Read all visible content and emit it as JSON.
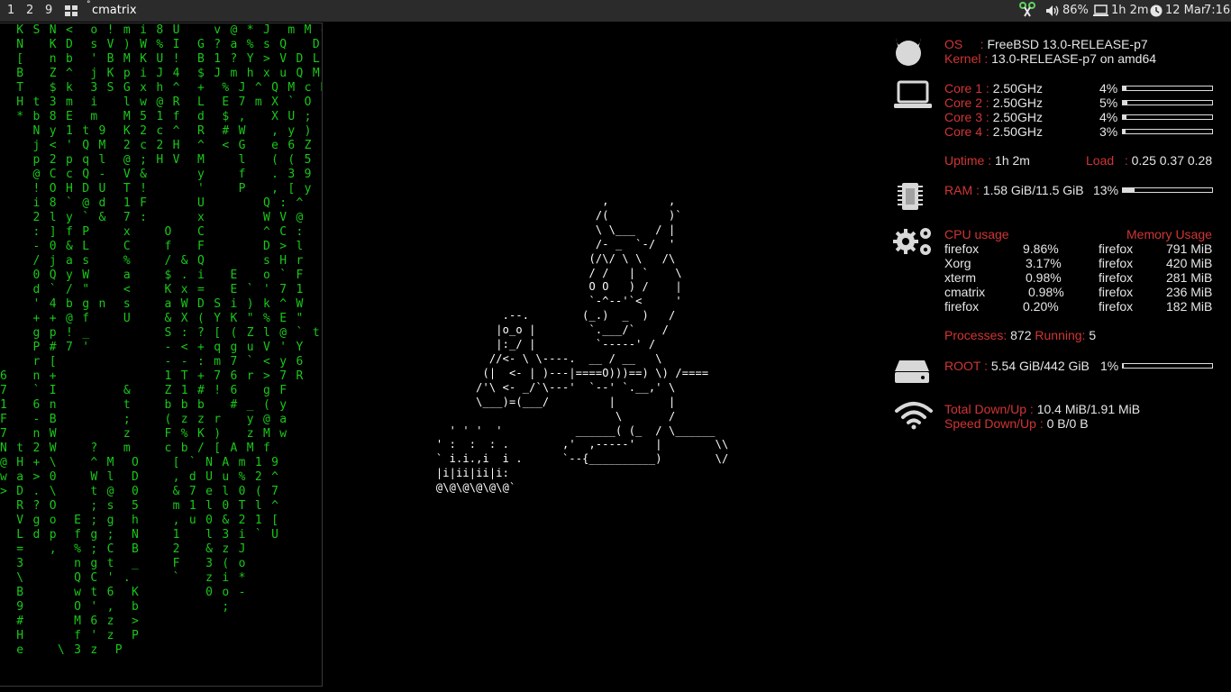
{
  "panel": {
    "workspaces": [
      "1",
      "2",
      "9"
    ],
    "window_title": "cmatrix",
    "volume": "86%",
    "uptime": "1h 2m",
    "date": "12 Mar",
    "time": "7:16",
    "colors": {
      "bg": "#2b2b2b",
      "fg": "#e6e6e6"
    }
  },
  "terminal": {
    "matrix": "  K S N <  o ! m i 8 U    v @ * J  m M d\n  N   K D  s V ) W % I  G ? a % s Q   D\n  [   n b  ' B M K U !  B 1 ? Y > V D L\n  B   Z ^  j K p i J 4  $ J m h x u Q M\n  T   $ k  3 S G x h ^  +  % J ^ Q M c M\n  H t 3 m  i   l w @ R  L  E 7 m X ` O\n  * b 8 E  m   M 5 1 f  d  $ ,   X U ;\n    N y 1 t 9  K 2 c ^  R  # W   , y )\n    j < ' Q M  2 c 2 H  ^  < G   e 6 Z\n    p 2 p q l  @ ; H V  M    l   ( ( 5\n    @ C c Q -  V &      y    f   . 3 9\n    ! O H D U  T !      '    P   , [ y\n    i 8 ` @ d  1 F      U       Q : ^\n    2 l y ` &  7 :      x       W V @\n    : ] f P    x    O   C       ^ C :\n    - 0 & L    C    f   F       D > l\n    / j a s    %    / & Q       s H r\n    0 Q y W    a    $ . i   E   o ` F\n    d ` / \"    <    K x =   E ` ' 7 1\n    ' 4 b g n  s    a W D S i ) k ^ W\n    + + @ f    U    & X ( Y K \" % E \"\n    g p ! _         S : ? [ ( Z l @ ` t\n    P # 7 '         - < + q g u V ' Y\n    r [             - - : m 7 ` < y 6\n6   n +             1 T + 7 6 r > 7 R\n7   ` I        &    Z 1 # ! 6   g F\n1   6 n        t    b b b   # _ ( y\nF   - B        ;    ( z z r   y @ a\n7   n W        z    F % K )   z M w\nN t 2 W    ?   m    c b / [ A M f\n@ H + \\    ^ M  O    [ ` N A m 1 9\nw a > 0    W l  D    , d U u % 2 ^\n> D . \\    t @  0    & 7 e l 0 ( 7\n  R ? O    ; s  5    m 1 l 0 T l ^\n  V g o  E ; g  h    , u 0 & 2 1 [\n  L d p  f g ;  N    1   l 3 i ` U\n  =   ,  % ; C  B    2   & z J\n  3      n g t  _    F   3 ( o\n  \\      Q C ' .     `   z i *\n  B      w t 6  K        0 o -\n  9      O ' ,  b          ;\n  #      M 6 z  >\n  H      f ' z  P\n  e    \\ 3 z  P",
    "color": "#19c819"
  },
  "ascii_art": "                              ,         ,\n                             /(         )`\n                             \\ \\___   / |\n                             /- _  `-/  '\n                            (/\\/ \\ \\   /\\\n                            / /   | `    \\\n                            O O   ) /    |\n                            `-^--'`<     '\n               .--.        (_.)  _  )   /\n              |o_o |        `.___/`    /\n              |:_/ |         `-----' /\n             //<- \\ \\----.  __ / __   \\\n            (|  <- | )---|====O)))==) \\) /====\n           /'\\ <- _/`\\---'  `--' `.__,' \\\n           \\___)=(___/         |        |\n                                \\       /\n       ' ' '  '           ______( (_  / \\______\n     ' :  :  : .        ,'  ,-----'   |        \\\\\n     ` i.i.,i  i .      `--{__________)        \\/\n     |i|ii|ii|i:\n     @\\@\\@\\@\\@\\@`",
  "conky": {
    "os_label": "OS",
    "os_value": "FreeBSD 13.0-RELEASE-p7",
    "kernel_label": "Kernel",
    "kernel_value": "13.0-RELEASE-p7 on amd64",
    "cores": [
      {
        "label": "Core 1",
        "freq": "2.50GHz",
        "pct": "4%",
        "level": 4
      },
      {
        "label": "Core 2",
        "freq": "2.50GHz",
        "pct": "5%",
        "level": 5
      },
      {
        "label": "Core 3",
        "freq": "2.50GHz",
        "pct": "4%",
        "level": 4
      },
      {
        "label": "Core 4",
        "freq": "2.50GHz",
        "pct": "3%",
        "level": 3
      }
    ],
    "uptime_label": "Uptime",
    "uptime_value": "1h 2m",
    "load_label": "Load",
    "load_value": "0.25 0.37 0.28",
    "ram_label": "RAM",
    "ram_value": "1.58 GiB/11.5 GiB",
    "ram_pct": "13%",
    "ram_level": 13,
    "cpu_usage_title": "CPU usage",
    "mem_usage_title": "Memory Usage",
    "cpu_procs": [
      {
        "name": "firefox",
        "val": "9.86%"
      },
      {
        "name": "Xorg",
        "val": "3.17%"
      },
      {
        "name": "xterm",
        "val": "0.98%"
      },
      {
        "name": "cmatrix",
        "val": "0.98%"
      },
      {
        "name": "firefox",
        "val": "0.20%"
      }
    ],
    "mem_procs": [
      {
        "name": "firefox",
        "val": "791 MiB"
      },
      {
        "name": "firefox",
        "val": "420 MiB"
      },
      {
        "name": "firefox",
        "val": "281 MiB"
      },
      {
        "name": "firefox",
        "val": "236 MiB"
      },
      {
        "name": "firefox",
        "val": "182 MiB"
      }
    ],
    "processes_label": "Processes:",
    "processes_value": "872",
    "running_label": "Running:",
    "running_value": "5",
    "root_label": "ROOT",
    "root_value": "5.54 GiB/442 GiB",
    "root_pct": "1%",
    "root_level": 1,
    "net_total_label": "Total Down/Up",
    "net_total_value": "10.4 MiB/1.91 MiB",
    "net_speed_label": "Speed Down/Up",
    "net_speed_value": "0 B/0 B",
    "colors": {
      "label": "#d13535",
      "value": "#e6e6e6",
      "icon": "#d8d8d8"
    }
  }
}
